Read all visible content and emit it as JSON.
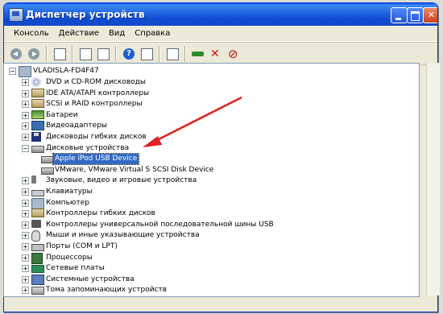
{
  "window": {
    "title": "Диспетчер устройств"
  },
  "menu": [
    "Консоль",
    "Действие",
    "Вид",
    "Справка"
  ],
  "tree": {
    "root": "VLADISLA-FD4F47",
    "items": [
      {
        "label": "DVD и CD-ROM дисководы",
        "icon": "cdrom-icon",
        "expand": "+"
      },
      {
        "label": "IDE ATA/ATAPI контроллеры",
        "icon": "ide-controller-icon",
        "expand": "+"
      },
      {
        "label": "SCSI и RAID контроллеры",
        "icon": "scsi-controller-icon",
        "expand": "+"
      },
      {
        "label": "Батареи",
        "icon": "battery-icon",
        "expand": "+"
      },
      {
        "label": "Видеоадаптеры",
        "icon": "display-adapter-icon",
        "expand": "+"
      },
      {
        "label": "Дисководы гибких дисков",
        "icon": "floppy-icon",
        "expand": "+"
      },
      {
        "label": "Дисковые устройства",
        "icon": "disk-drive-icon",
        "expand": "−"
      },
      {
        "label": "Apple iPod USB Device",
        "icon": "disk-drive-icon",
        "child": true,
        "selected": true
      },
      {
        "label": "VMware, VMware Virtual S SCSI Disk Device",
        "icon": "disk-drive-icon",
        "child": true
      },
      {
        "label": "Звуковые, видео и игровые устройства",
        "icon": "sound-icon",
        "expand": "+"
      },
      {
        "label": "Клавиатуры",
        "icon": "keyboard-icon",
        "expand": "+"
      },
      {
        "label": "Компьютер",
        "icon": "computer-icon",
        "expand": "+"
      },
      {
        "label": "Контроллеры гибких дисков",
        "icon": "floppy-controller-icon",
        "expand": "+"
      },
      {
        "label": "Контроллеры универсальной последовательной шины USB",
        "icon": "usb-controller-icon",
        "expand": "+"
      },
      {
        "label": "Мыши и иные указывающие устройства",
        "icon": "mouse-icon",
        "expand": "+"
      },
      {
        "label": "Порты (COM и LPT)",
        "icon": "port-icon",
        "expand": "+"
      },
      {
        "label": "Процессоры",
        "icon": "cpu-icon",
        "expand": "+"
      },
      {
        "label": "Сетевые платы",
        "icon": "network-adapter-icon",
        "expand": "+"
      },
      {
        "label": "Системные устройства",
        "icon": "system-device-icon",
        "expand": "+"
      },
      {
        "label": "Тома запоминающих устройств",
        "icon": "storage-volume-icon",
        "expand": "+"
      }
    ]
  },
  "colors": {
    "titlebar": "#1f63e1",
    "selection": "#316ac5",
    "annotation_arrow": "#e02020"
  }
}
